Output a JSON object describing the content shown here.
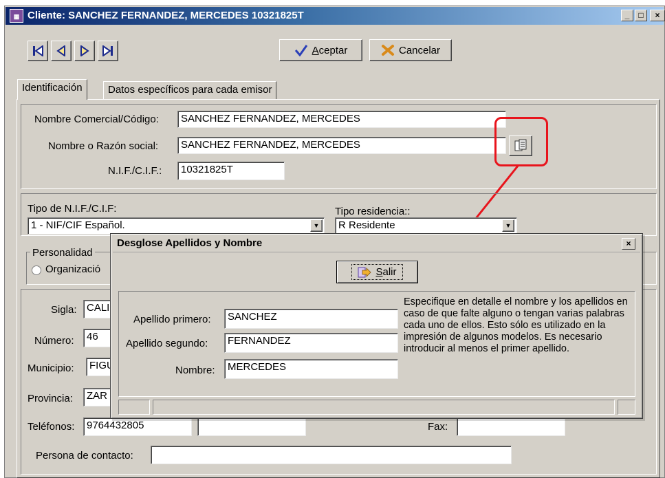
{
  "window": {
    "title": "Cliente: SANCHEZ FERNANDEZ, MERCEDES 10321825T",
    "controls": [
      "_",
      "□",
      "×"
    ]
  },
  "toolbar": {
    "nav_first": "first-record",
    "nav_prev": "previous-record",
    "nav_next": "next-record",
    "nav_last": "last-record",
    "accept_label": "Aceptar",
    "accept_mnemonic": "A",
    "accept_rest": "ceptar",
    "cancel_label": "Cancelar"
  },
  "tabs": [
    {
      "label": "Identificación",
      "active": true
    },
    {
      "label": "Datos específicos para cada emisor",
      "active": false
    }
  ],
  "identification": {
    "commercial_name_label": "Nombre Comercial/Código:",
    "commercial_name_value": "SANCHEZ FERNANDEZ, MERCEDES",
    "business_name_label": "Nombre o Razón social:",
    "business_name_value": "SANCHEZ FERNANDEZ, MERCEDES",
    "nif_label": "N.I.F./C.I.F.:",
    "nif_value": "10321825T"
  },
  "types": {
    "nif_type_label": "Tipo de N.I.F./C.I.F:",
    "nif_type_value": "1 - NIF/CIF Español.",
    "residence_label": "Tipo residencia::",
    "residence_value": "R Residente"
  },
  "personality": {
    "group_label": "Personalidad",
    "option_org": "Organizació"
  },
  "address": {
    "sigla_label": "Sigla:",
    "sigla_value": "CALI",
    "numero_label": "Número:",
    "numero_value": "46",
    "municipio_label": "Municipio:",
    "municipio_value": "FIGU",
    "provincia_label": "Provincia:",
    "provincia_value": "ZAR",
    "telefonos_label": "Teléfonos:",
    "telefono1_value": "9764432805",
    "telefono2_value": "",
    "fax_label": "Fax:",
    "fax_value": "",
    "contacto_label": "Persona de contacto:",
    "contacto_value": ""
  },
  "dialog": {
    "title": "Desglose Apellidos y Nombre",
    "close": "×",
    "exit_mnemonic": "S",
    "exit_rest": "alir",
    "first_surname_label": "Apellido primero:",
    "first_surname_value": "SANCHEZ",
    "second_surname_label": "Apellido segundo:",
    "second_surname_value": "FERNANDEZ",
    "name_label": "Nombre:",
    "name_value": "MERCEDES",
    "help_text": "Especifique en detalle el nombre y los apellidos en caso de que falte alguno o tengan varias palabras cada uno de ellos. Esto sólo es utilizado en la impresión de algunos modelos. Es necesario introducir al menos el primer apellido."
  },
  "colors": {
    "titlebar_start": "#0a246a",
    "titlebar_end": "#a6caf0",
    "annotation_red": "#e8141c",
    "face": "#d4d0c8"
  }
}
